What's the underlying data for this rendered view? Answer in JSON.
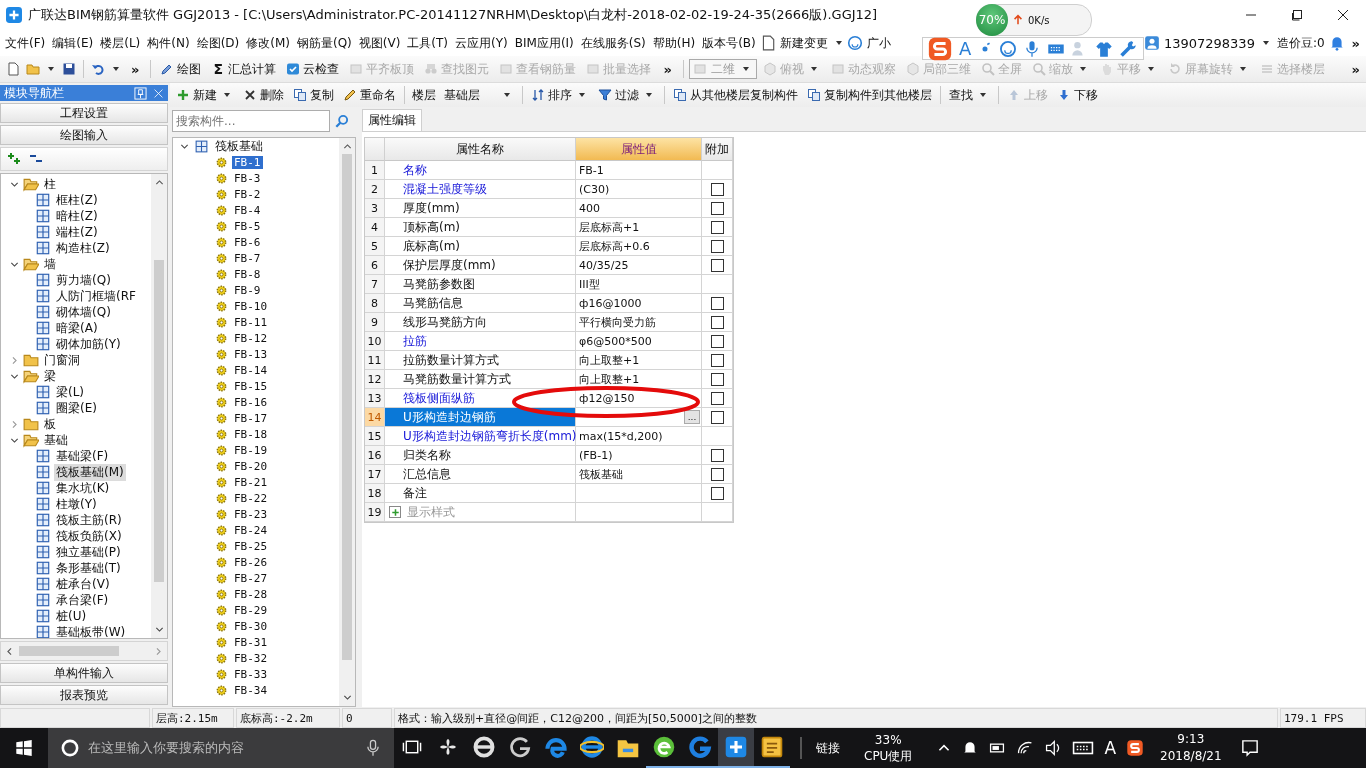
{
  "window": {
    "title": "广联达BIM钢筋算量软件 GGJ2013 - [C:\\Users\\Administrator.PC-20141127NRHM\\Desktop\\白龙村-2018-02-02-19-24-35(2666版).GGJ12]"
  },
  "menu": {
    "items": [
      "文件(F)",
      "编辑(E)",
      "楼层(L)",
      "构件(N)",
      "绘图(D)",
      "修改(M)",
      "钢筋量(Q)",
      "视图(V)",
      "工具(T)",
      "云应用(Y)",
      "BIM应用(I)",
      "在线服务(S)",
      "帮助(H)",
      "版本号(B)"
    ],
    "change_button": "新建变更",
    "assistant": "广小",
    "account": "13907298339",
    "beans": "造价豆:0",
    "overflow": "»"
  },
  "toolbar": {
    "overflow": "»",
    "items": [
      {
        "label": "绘图",
        "disabled": false
      },
      {
        "label": "汇总计算",
        "glyph": "Σ",
        "disabled": false
      },
      {
        "label": "云检查",
        "disabled": false
      },
      {
        "label": "平齐板顶",
        "disabled": true
      },
      {
        "label": "查找图元",
        "disabled": true
      },
      {
        "label": "查看钢筋量",
        "disabled": true
      },
      {
        "label": "批量选择",
        "disabled": true
      }
    ],
    "view_mode": "二维",
    "view_items": [
      {
        "label": "俯视",
        "dropdown": true
      },
      {
        "label": "动态观察",
        "dropdown": false
      },
      {
        "label": "局部三维",
        "dropdown": false
      },
      {
        "label": "全屏",
        "dropdown": false
      },
      {
        "label": "缩放",
        "dropdown": true
      },
      {
        "label": "平移",
        "dropdown": true
      },
      {
        "label": "屏幕旋转",
        "dropdown": true
      },
      {
        "label": "选择楼层",
        "dropdown": false
      }
    ],
    "view_overflow": "»"
  },
  "nav": {
    "title": "模块导航栏",
    "top_buttons": [
      "工程设置",
      "绘图输入"
    ],
    "tree": [
      {
        "label": "柱",
        "expanded": true,
        "selected": false,
        "children": [
          {
            "label": "框柱(Z)",
            "selected": false
          },
          {
            "label": "暗柱(Z)",
            "selected": false
          },
          {
            "label": "端柱(Z)",
            "selected": false
          },
          {
            "label": "构造柱(Z)",
            "selected": false
          }
        ]
      },
      {
        "label": "墙",
        "expanded": true,
        "selected": false,
        "children": [
          {
            "label": "剪力墙(Q)",
            "selected": false
          },
          {
            "label": "人防门框墙(RF",
            "selected": false
          },
          {
            "label": "砌体墙(Q)",
            "selected": false
          },
          {
            "label": "暗梁(A)",
            "selected": false
          },
          {
            "label": "砌体加筋(Y)",
            "selected": false
          }
        ]
      },
      {
        "label": "门窗洞",
        "expanded": false,
        "selected": false
      },
      {
        "label": "梁",
        "expanded": true,
        "selected": false,
        "children": [
          {
            "label": "梁(L)",
            "selected": false
          },
          {
            "label": "圈梁(E)",
            "selected": false
          }
        ]
      },
      {
        "label": "板",
        "expanded": false,
        "selected": false
      },
      {
        "label": "基础",
        "expanded": true,
        "selected": false,
        "children": [
          {
            "label": "基础梁(F)",
            "selected": false
          },
          {
            "label": "筏板基础(M)",
            "selected": true
          },
          {
            "label": "集水坑(K)",
            "selected": false
          },
          {
            "label": "柱墩(Y)",
            "selected": false
          },
          {
            "label": "筏板主筋(R)",
            "selected": false
          },
          {
            "label": "筏板负筋(X)",
            "selected": false
          },
          {
            "label": "独立基础(P)",
            "selected": false
          },
          {
            "label": "条形基础(T)",
            "selected": false
          },
          {
            "label": "桩承台(V)",
            "selected": false
          },
          {
            "label": "承台梁(F)",
            "selected": false
          },
          {
            "label": "桩(U)",
            "selected": false
          },
          {
            "label": "基础板带(W)",
            "selected": false
          }
        ]
      }
    ],
    "bottom_buttons": [
      "单构件输入",
      "报表预览"
    ]
  },
  "component_toolbar": {
    "items": [
      {
        "label": "新建",
        "dropdown": true,
        "disabled": false
      },
      {
        "label": "删除",
        "dropdown": false,
        "disabled": false
      },
      {
        "label": "复制",
        "dropdown": false,
        "disabled": false
      },
      {
        "label": "重命名",
        "dropdown": false,
        "disabled": false
      }
    ],
    "floor_label": "楼层",
    "floor": "基础层",
    "items2": [
      {
        "label": "排序",
        "dropdown": true,
        "disabled": false
      },
      {
        "label": "过滤",
        "dropdown": true,
        "disabled": false
      },
      {
        "label": "从其他楼层复制构件",
        "dropdown": false,
        "disabled": false
      },
      {
        "label": "复制构件到其他楼层",
        "dropdown": false,
        "disabled": false
      },
      {
        "label": "查找",
        "dropdown": true,
        "disabled": false
      },
      {
        "label": "上移",
        "dropdown": false,
        "disabled": true
      },
      {
        "label": "下移",
        "dropdown": false,
        "disabled": false
      }
    ]
  },
  "components": {
    "search_placeholder": "搜索构件...",
    "root": {
      "label": "筏板基础",
      "expanded": true,
      "children": [
        {
          "label": "FB-1",
          "selected": true
        },
        {
          "label": "FB-3",
          "selected": false
        },
        {
          "label": "FB-2",
          "selected": false
        },
        {
          "label": "FB-4",
          "selected": false
        },
        {
          "label": "FB-5",
          "selected": false
        },
        {
          "label": "FB-6",
          "selected": false
        },
        {
          "label": "FB-7",
          "selected": false
        },
        {
          "label": "FB-8",
          "selected": false
        },
        {
          "label": "FB-9",
          "selected": false
        },
        {
          "label": "FB-10",
          "selected": false
        },
        {
          "label": "FB-11",
          "selected": false
        },
        {
          "label": "FB-12",
          "selected": false
        },
        {
          "label": "FB-13",
          "selected": false
        },
        {
          "label": "FB-14",
          "selected": false
        },
        {
          "label": "FB-15",
          "selected": false
        },
        {
          "label": "FB-16",
          "selected": false
        },
        {
          "label": "FB-17",
          "selected": false
        },
        {
          "label": "FB-18",
          "selected": false
        },
        {
          "label": "FB-19",
          "selected": false
        },
        {
          "label": "FB-20",
          "selected": false
        },
        {
          "label": "FB-21",
          "selected": false
        },
        {
          "label": "FB-22",
          "selected": false
        },
        {
          "label": "FB-23",
          "selected": false
        },
        {
          "label": "FB-24",
          "selected": false
        },
        {
          "label": "FB-25",
          "selected": false
        },
        {
          "label": "FB-26",
          "selected": false
        },
        {
          "label": "FB-27",
          "selected": false
        },
        {
          "label": "FB-28",
          "selected": false
        },
        {
          "label": "FB-29",
          "selected": false
        },
        {
          "label": "FB-30",
          "selected": false
        },
        {
          "label": "FB-31",
          "selected": false
        },
        {
          "label": "FB-32",
          "selected": false
        },
        {
          "label": "FB-33",
          "selected": false
        },
        {
          "label": "FB-34",
          "selected": false
        }
      ]
    }
  },
  "properties": {
    "tab": "属性编辑",
    "columns": [
      "属性名称",
      "属性值",
      "附加"
    ],
    "rows": [
      {
        "num": "1",
        "name": "名称",
        "kind": "property",
        "link": true,
        "value": "FB-1",
        "selected": false
      },
      {
        "num": "2",
        "name": "混凝土强度等级",
        "kind": "property",
        "link": true,
        "value": "(C30)",
        "checked": false,
        "selected": false
      },
      {
        "num": "3",
        "name": "厚度(mm)",
        "kind": "property",
        "link": false,
        "value": "400",
        "checked": false,
        "selected": false
      },
      {
        "num": "4",
        "name": "顶标高(m)",
        "kind": "property",
        "link": false,
        "value": "层底标高+1",
        "checked": false,
        "selected": false
      },
      {
        "num": "5",
        "name": "底标高(m)",
        "kind": "property",
        "link": false,
        "value": "层底标高+0.6",
        "checked": false,
        "selected": false
      },
      {
        "num": "6",
        "name": "保护层厚度(mm)",
        "kind": "property",
        "link": false,
        "value": "40/35/25",
        "checked": false,
        "selected": false
      },
      {
        "num": "7",
        "name": "马凳筋参数图",
        "kind": "property",
        "link": false,
        "value": "III型",
        "selected": false
      },
      {
        "num": "8",
        "name": "马凳筋信息",
        "kind": "property",
        "link": false,
        "value": "ф16@1000",
        "checked": false,
        "selected": false
      },
      {
        "num": "9",
        "name": "线形马凳筋方向",
        "kind": "property",
        "link": false,
        "value": "平行横向受力筋",
        "checked": false,
        "selected": false
      },
      {
        "num": "10",
        "name": "拉筋",
        "kind": "property",
        "link": true,
        "value": "φ6@500*500",
        "checked": false,
        "selected": false
      },
      {
        "num": "11",
        "name": "拉筋数量计算方式",
        "kind": "property",
        "link": false,
        "value": "向上取整+1",
        "checked": false,
        "selected": false
      },
      {
        "num": "12",
        "name": "马凳筋数量计算方式",
        "kind": "property",
        "link": false,
        "value": "向上取整+1",
        "checked": false,
        "selected": false
      },
      {
        "num": "13",
        "name": "筏板侧面纵筋",
        "kind": "property",
        "link": true,
        "value": "ф12@150",
        "checked": false,
        "selected": false
      },
      {
        "num": "14",
        "name": "U形构造封边钢筋",
        "kind": "property",
        "link": true,
        "editor_button": "...",
        "checked": false,
        "selected": true
      },
      {
        "num": "15",
        "name": "U形构造封边钢筋弯折长度(mm)",
        "kind": "property",
        "link": true,
        "value": "max(15*d,200)",
        "selected": false
      },
      {
        "num": "16",
        "name": "归类名称",
        "kind": "property",
        "link": false,
        "value": "(FB-1)",
        "checked": false,
        "selected": false
      },
      {
        "num": "17",
        "name": "汇总信息",
        "kind": "property",
        "link": false,
        "value": "筏板基础",
        "checked": false,
        "selected": false
      },
      {
        "num": "18",
        "name": "备注",
        "kind": "property",
        "link": false,
        "checked": false,
        "selected": false
      },
      {
        "num": "19",
        "name": "显示样式",
        "kind": "group",
        "link": false,
        "expanded": false,
        "selected": false
      }
    ],
    "annotation": {
      "kind": "ellipse"
    }
  },
  "status_bar": {
    "floor_height": "层高:2.15m",
    "bottom_elevation": "底标高:-2.2m",
    "count": "0",
    "hint": "格式：输入级别+直径@间距，C12@200，间距为[50,5000]之间的整数",
    "fps": "179.1 FPS"
  },
  "floating": {
    "speed_percent": "70%",
    "speed": "0K/s",
    "ime_mode": "A"
  },
  "taskbar": {
    "search_placeholder": "在这里输入你要搜索的内容",
    "apps": [
      {
        "running": false,
        "active": false
      },
      {
        "running": false,
        "active": false
      },
      {
        "running": false,
        "active": false
      },
      {
        "running": false,
        "active": false
      },
      {
        "running": false,
        "active": false
      },
      {
        "running": false,
        "active": false
      },
      {
        "running": true,
        "active": false
      },
      {
        "running": true,
        "active": false
      },
      {
        "running": true,
        "active": true
      },
      {
        "running": true,
        "active": false
      }
    ],
    "links": "链接",
    "cpu_value": "33%",
    "cpu_label": "CPU使用",
    "ime": "A",
    "time": "9:13",
    "date": "2018/8/21"
  }
}
